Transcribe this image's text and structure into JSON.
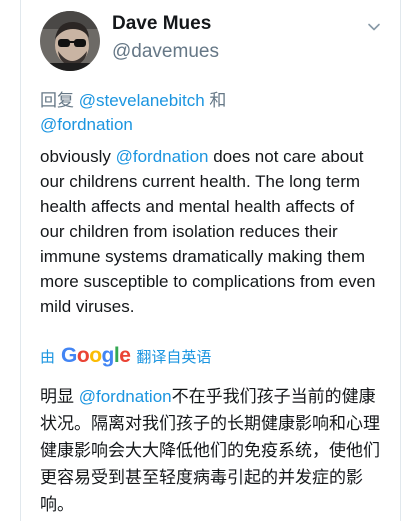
{
  "user": {
    "display_name": "Dave Mues",
    "handle": "@davemues"
  },
  "reply": {
    "prefix": "回复 ",
    "mention_1": "@stevelanebitch",
    "joiner": " 和",
    "mention_2": "@fordnation"
  },
  "tweet": {
    "before_mention": "obviously ",
    "mention": "@fordnation",
    "after_mention": " does not care about our childrens current health. The long term health affects and mental health affects of our children from isolation reduces their immune systems dramatically making them more susceptible to complications from even mild viruses."
  },
  "translate": {
    "by": "由",
    "brand": "Google",
    "label": "翻译自英语"
  },
  "translation": {
    "prefix": "明显 ",
    "mention": "@fordnation",
    "text": "不在乎我们孩子当前的健康状况。隔离对我们孩子的长期健康影响和心理健康影响会大大降低他们的免疫系统，使他们更容易受到甚至轻度病毒引起的并发症的影响。"
  },
  "colors": {
    "link": "#1b95e0",
    "secondary": "#657786",
    "primary_text": "#14171a",
    "google_blue": "#4285f4",
    "google_red": "#ea4335",
    "google_yellow": "#fbbc05",
    "google_green": "#34a853"
  },
  "icons": {
    "menu": "chevron-down-icon",
    "avatar": "profile-photo"
  }
}
